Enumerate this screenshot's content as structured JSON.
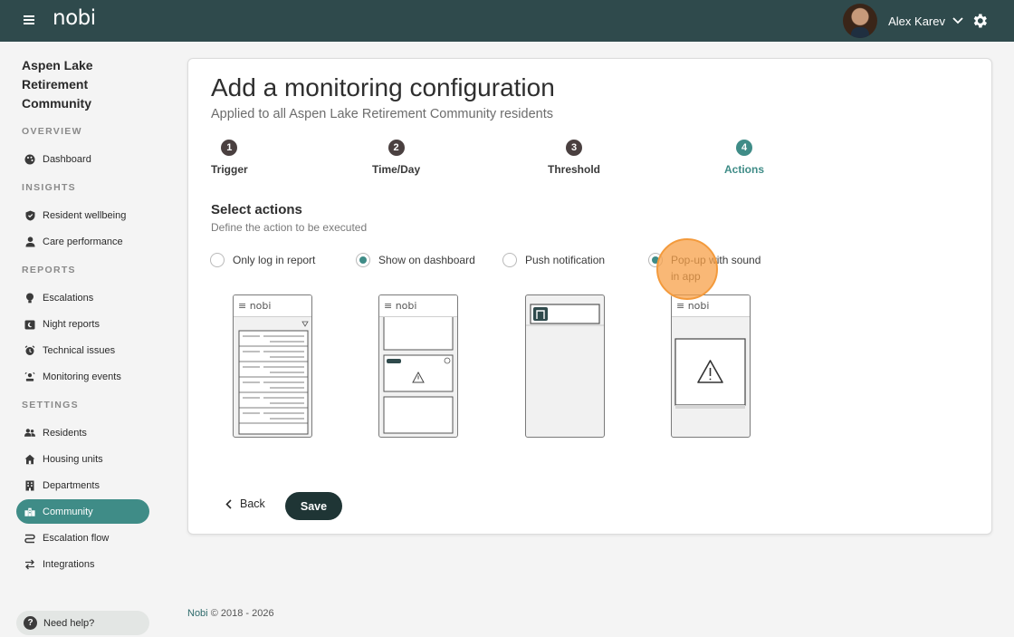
{
  "header": {
    "brand": "nobi",
    "user_name": "Alex Karev",
    "icons": [
      "hamburger-menu-icon",
      "chevron-down-icon",
      "gear-icon"
    ]
  },
  "sidebar": {
    "org_name": "Aspen Lake Retirement Community",
    "sections": [
      {
        "label": "OVERVIEW",
        "items": [
          {
            "label": "Dashboard",
            "icon": "palette-icon"
          }
        ]
      },
      {
        "label": "INSIGHTS",
        "items": [
          {
            "label": "Resident wellbeing",
            "icon": "shield-icon"
          },
          {
            "label": "Care performance",
            "icon": "person-icon"
          }
        ]
      },
      {
        "label": "REPORTS",
        "items": [
          {
            "label": "Escalations",
            "icon": "lightbulb-icon"
          },
          {
            "label": "Night reports",
            "icon": "moon-icon"
          },
          {
            "label": "Technical issues",
            "icon": "alarm-icon"
          },
          {
            "label": "Monitoring events",
            "icon": "monitoring-icon"
          }
        ]
      },
      {
        "label": "SETTINGS",
        "items": [
          {
            "label": "Residents",
            "icon": "people-icon"
          },
          {
            "label": "Housing units",
            "icon": "house-icon"
          },
          {
            "label": "Departments",
            "icon": "building-icon"
          },
          {
            "label": "Community",
            "icon": "community-icon",
            "active": true
          },
          {
            "label": "Escalation flow",
            "icon": "flow-icon"
          },
          {
            "label": "Integrations",
            "icon": "swap-icon"
          }
        ]
      }
    ],
    "help": "Need help?"
  },
  "main": {
    "title": "Add a monitoring configuration",
    "subtitle": "Applied to all Aspen Lake Retirement Community residents",
    "steps": [
      {
        "num": "1",
        "label": "Trigger"
      },
      {
        "num": "2",
        "label": "Time/Day"
      },
      {
        "num": "3",
        "label": "Threshold"
      },
      {
        "num": "4",
        "label": "Actions",
        "current": true
      }
    ],
    "section_title": "Select actions",
    "section_desc": "Define the action to be executed",
    "options": [
      {
        "label": "Only log in report",
        "checked": false
      },
      {
        "label": "Show on dashboard",
        "checked": true
      },
      {
        "label": "Push notification",
        "checked": false
      },
      {
        "label": "Pop-up with sound in app",
        "checked": true
      }
    ],
    "phone_brand": "≡ nobi",
    "back_label": "Back",
    "save_label": "Save"
  },
  "footer": {
    "brand": "Nobi",
    "copyright": "© 2018 - 2026"
  },
  "colors": {
    "topbar": "#2f4a4c",
    "accent": "#3f8c87",
    "save": "#1f3535"
  }
}
